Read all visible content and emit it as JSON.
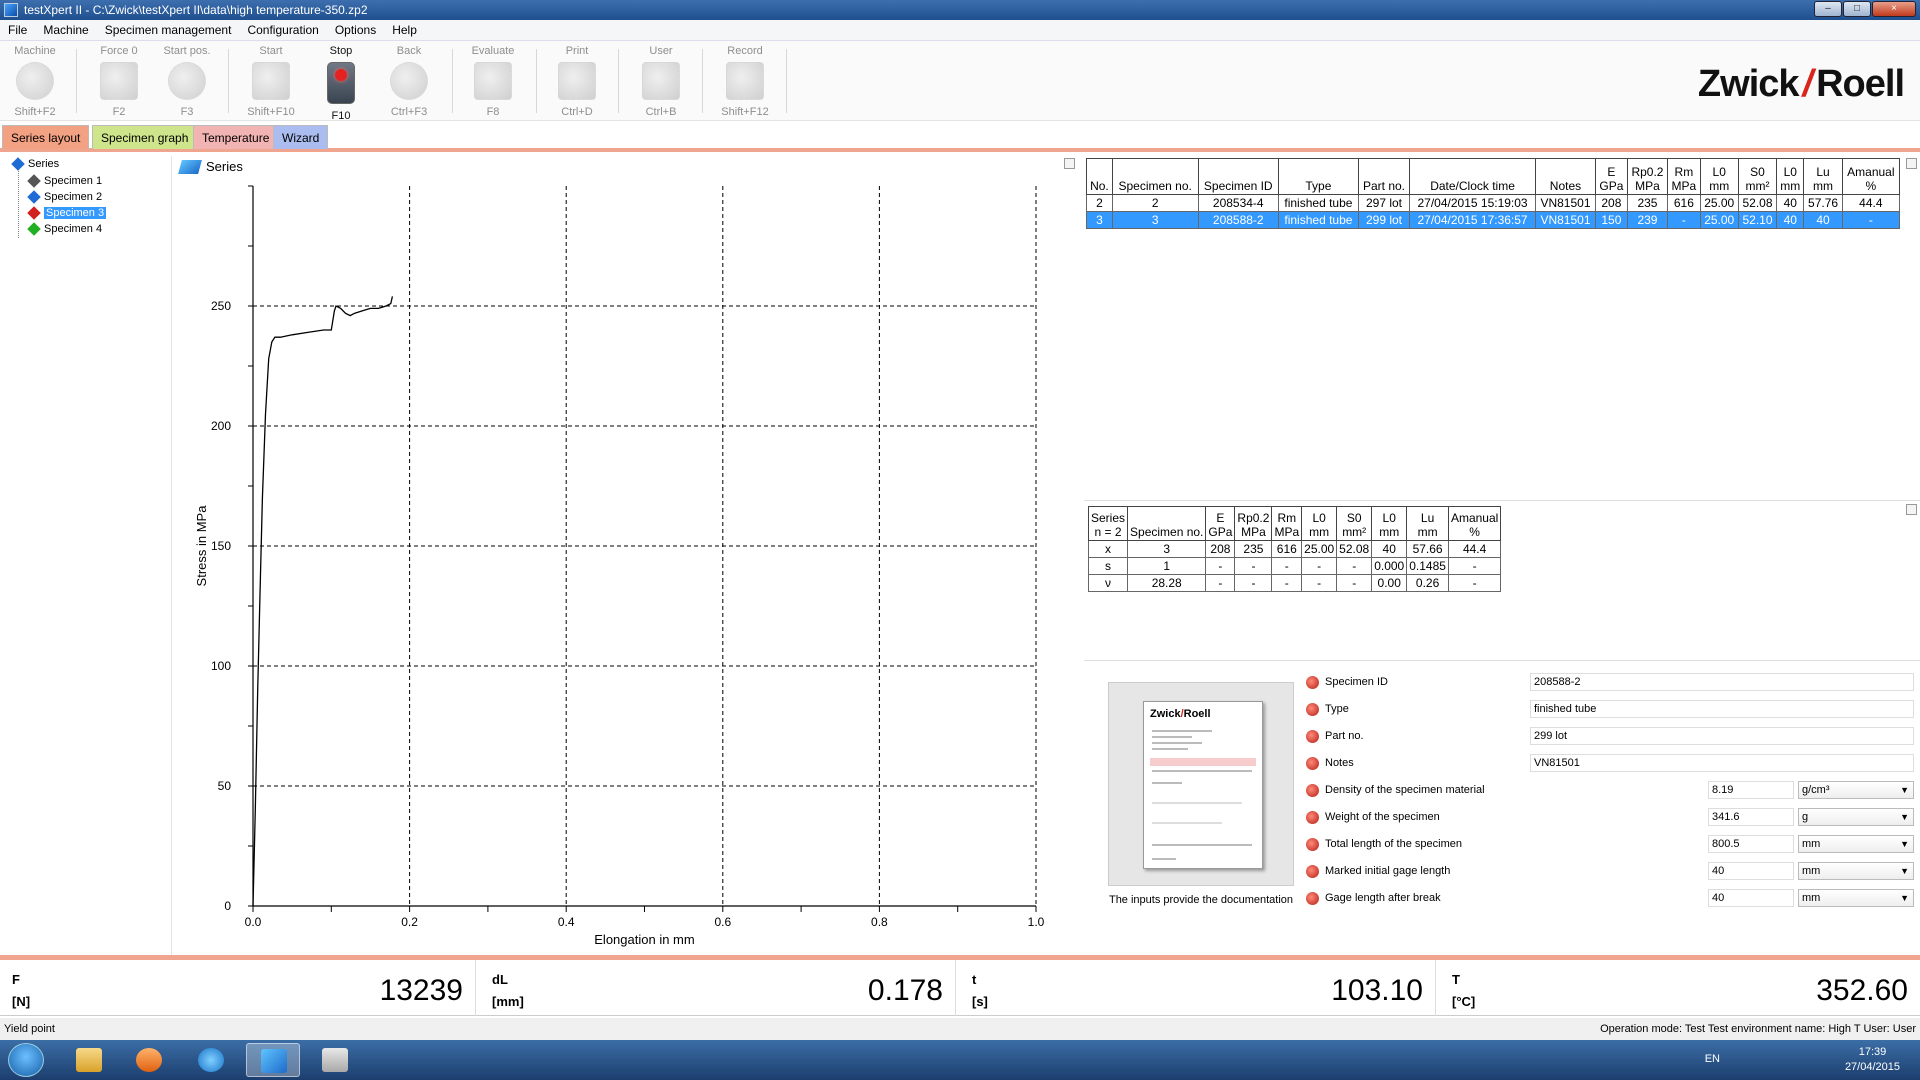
{
  "window": {
    "title": "testXpert II - C:\\Zwick\\testXpert II\\data\\high temperature-350.zp2",
    "controls": [
      "–",
      "□",
      "×"
    ]
  },
  "menu": [
    "File",
    "Machine",
    "Specimen management",
    "Configuration",
    "Options",
    "Help"
  ],
  "toolbar": {
    "tools": [
      {
        "label": "Machine",
        "key": "Shift+F2"
      },
      {
        "label": "Force 0",
        "key": "F2"
      },
      {
        "label": "Start pos.",
        "key": "F3"
      },
      {
        "label": "Start",
        "key": "Shift+F10"
      },
      {
        "label": "Stop",
        "key": "F10"
      },
      {
        "label": "Back",
        "key": "Ctrl+F3"
      },
      {
        "label": "Evaluate",
        "key": "F8"
      },
      {
        "label": "Print",
        "key": "Ctrl+D"
      },
      {
        "label": "User",
        "key": "Ctrl+B"
      },
      {
        "label": "Record",
        "key": "Shift+F12"
      }
    ],
    "logo_left": "Zwick",
    "logo_slash": "/",
    "logo_right": "Roell"
  },
  "tabs": [
    "Series layout",
    "Specimen graph",
    "Temperature",
    "Wizard"
  ],
  "tree": {
    "root": "Series",
    "items": [
      "Specimen 1",
      "Specimen 2",
      "Specimen 3",
      "Specimen 4"
    ],
    "selected_index": 2,
    "colors": [
      "#555555",
      "#1e6bd6",
      "#d02020",
      "#22b022"
    ]
  },
  "chart_panel": {
    "title": "Series"
  },
  "chart_data": {
    "type": "line",
    "xlabel": "Elongation in mm",
    "ylabel": "Stress in MPa",
    "xlim": [
      0,
      1.0
    ],
    "ylim": [
      0,
      300
    ],
    "xticks": [
      "0.0",
      "0.2",
      "0.4",
      "0.6",
      "0.8",
      "1.0"
    ],
    "yticks": [
      "0",
      "50",
      "100",
      "150",
      "200",
      "250"
    ],
    "grid": true,
    "series": [
      {
        "x": [
          0.0,
          0.003,
          0.006,
          0.009,
          0.012,
          0.016,
          0.02,
          0.024,
          0.028,
          0.035,
          0.05,
          0.07,
          0.09,
          0.1,
          0.104,
          0.106,
          0.112,
          0.118,
          0.124,
          0.13,
          0.14,
          0.15,
          0.16,
          0.17,
          0.176,
          0.178
        ],
        "y": [
          0,
          40,
          90,
          130,
          170,
          205,
          228,
          235,
          237,
          237,
          238,
          239,
          240,
          240,
          248,
          250,
          249,
          247,
          246,
          247,
          248,
          249,
          249,
          250,
          251,
          254
        ]
      }
    ]
  },
  "results_table": {
    "headers": [
      {
        "l1": "",
        "l2": "No."
      },
      {
        "l1": "Specimen no.",
        "l2": ""
      },
      {
        "l1": "Specimen ID",
        "l2": ""
      },
      {
        "l1": "Type",
        "l2": ""
      },
      {
        "l1": "Part no.",
        "l2": ""
      },
      {
        "l1": "Date/Clock time",
        "l2": ""
      },
      {
        "l1": "Notes",
        "l2": ""
      },
      {
        "l1": "E",
        "l2": "GPa"
      },
      {
        "l1": "Rp0.2",
        "l2": "MPa"
      },
      {
        "l1": "Rm",
        "l2": "MPa"
      },
      {
        "l1": "L0",
        "l2": "mm"
      },
      {
        "l1": "S0",
        "l2": "mm²"
      },
      {
        "l1": "L0",
        "l2": "mm"
      },
      {
        "l1": "Lu",
        "l2": "mm"
      },
      {
        "l1": "Amanual",
        "l2": "%"
      }
    ],
    "rows": [
      [
        "2",
        "2",
        "208534-4",
        "finished tube",
        "297 lot",
        "27/04/2015 15:19:03",
        "VN81501",
        "208",
        "235",
        "616",
        "25.00",
        "52.08",
        "40",
        "57.76",
        "44.4"
      ],
      [
        "3",
        "3",
        "208588-2",
        "finished tube",
        "299 lot",
        "27/04/2015 17:36:57",
        "VN81501",
        "150",
        "239",
        "-",
        "25.00",
        "52.10",
        "40",
        "40",
        "-"
      ]
    ],
    "selected_row": 1
  },
  "stats_table": {
    "headers": [
      {
        "l1": "Series",
        "l2": "n = 2"
      },
      {
        "l1": "Specimen no.",
        "l2": ""
      },
      {
        "l1": "E",
        "l2": "GPa"
      },
      {
        "l1": "Rp0.2",
        "l2": "MPa"
      },
      {
        "l1": "Rm",
        "l2": "MPa"
      },
      {
        "l1": "L0",
        "l2": "mm"
      },
      {
        "l1": "S0",
        "l2": "mm²"
      },
      {
        "l1": "L0",
        "l2": "mm"
      },
      {
        "l1": "Lu",
        "l2": "mm"
      },
      {
        "l1": "Amanual",
        "l2": "%"
      }
    ],
    "rows": [
      [
        "x",
        "3",
        "208",
        "235",
        "616",
        "25.00",
        "52.08",
        "40",
        "57.66",
        "44.4"
      ],
      [
        "s",
        "1",
        "-",
        "-",
        "-",
        "-",
        "-",
        "0.000",
        "0.1485",
        "-"
      ],
      [
        "ν",
        "28.28",
        "-",
        "-",
        "-",
        "-",
        "-",
        "0.00",
        "0.26",
        "-"
      ]
    ]
  },
  "documentation": {
    "caption": "The inputs provide the documentation",
    "thumb_logo_left": "Zwick",
    "thumb_logo_right": "Roell"
  },
  "inputs": [
    {
      "label": "Specimen ID",
      "value": "208588-2",
      "unit": ""
    },
    {
      "label": "Type",
      "value": "finished tube",
      "unit": ""
    },
    {
      "label": "Part no.",
      "value": "299 lot",
      "unit": ""
    },
    {
      "label": "Notes",
      "value": "VN81501",
      "unit": ""
    },
    {
      "label": "Density of the specimen material",
      "value": "8.19",
      "unit": "g/cm³"
    },
    {
      "label": "Weight of the specimen",
      "value": "341.6",
      "unit": "g"
    },
    {
      "label": "Total length of the specimen",
      "value": "800.5",
      "unit": "mm"
    },
    {
      "label": "Marked initial gage length",
      "value": "40",
      "unit": "mm"
    },
    {
      "label": "Gage length after break",
      "value": "40",
      "unit": "mm"
    }
  ],
  "readouts": [
    {
      "name": "F",
      "unit": "[N]",
      "value": "13239"
    },
    {
      "name": "dL",
      "unit": "[mm]",
      "value": "0.178"
    },
    {
      "name": "t",
      "unit": "[s]",
      "value": "103.10"
    },
    {
      "name": "T",
      "unit": "[°C]",
      "value": "352.60"
    }
  ],
  "status": {
    "left": "Yield point",
    "right": "Operation mode: Test    Test environment name: High T    User: User"
  },
  "taskbar": {
    "lang": "EN",
    "time": "17:39",
    "date": "27/04/2015"
  }
}
